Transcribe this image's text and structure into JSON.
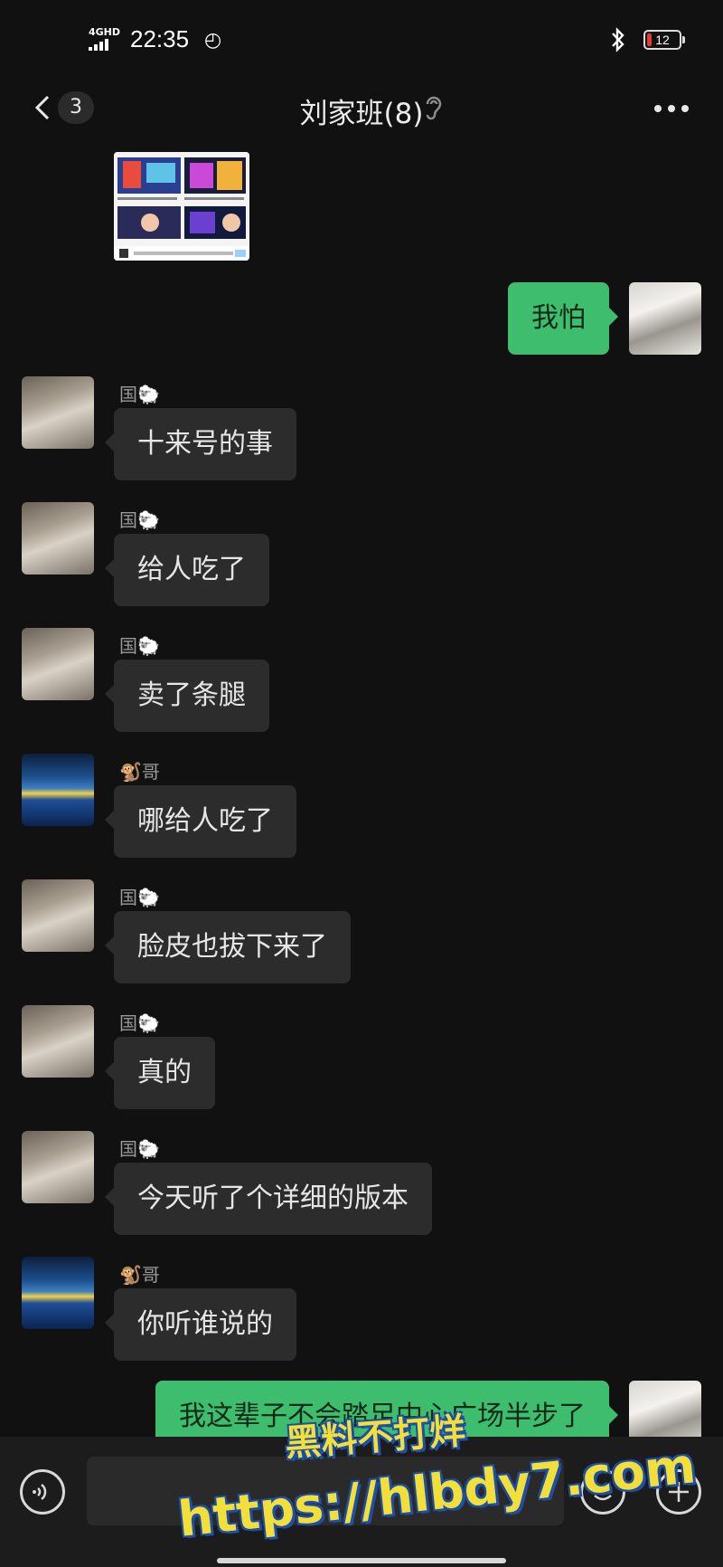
{
  "status_bar": {
    "network": "4GHD",
    "time": "22:35",
    "battery": "12"
  },
  "header": {
    "back_count": "3",
    "title": "刘家班(8)"
  },
  "messages": [
    {
      "side": "right",
      "text": "我怕"
    },
    {
      "side": "left",
      "sender": "国🐑",
      "text": "十来号的事"
    },
    {
      "side": "left",
      "sender": "国🐑",
      "text": "给人吃了"
    },
    {
      "side": "left",
      "sender": "国🐑",
      "text": "卖了条腿"
    },
    {
      "side": "left",
      "sender": "🐒哥",
      "text": "哪给人吃了"
    },
    {
      "side": "left",
      "sender": "国🐑",
      "text": "脸皮也拔下来了"
    },
    {
      "side": "left",
      "sender": "国🐑",
      "text": "真的"
    },
    {
      "side": "left",
      "sender": "国🐑",
      "text": "今天听了个详细的版本"
    },
    {
      "side": "left",
      "sender": "🐒哥",
      "text": "你听谁说的"
    },
    {
      "side": "right",
      "text": "我这辈子不会踏足中心广场半步了"
    }
  ],
  "watermark": {
    "line1": "黑料不打烊",
    "line2": "https://hlbdy7.com"
  },
  "colors": {
    "background": "#111111",
    "bubble_out": "#3ebd6e",
    "bubble_in": "#2c2c2c"
  }
}
